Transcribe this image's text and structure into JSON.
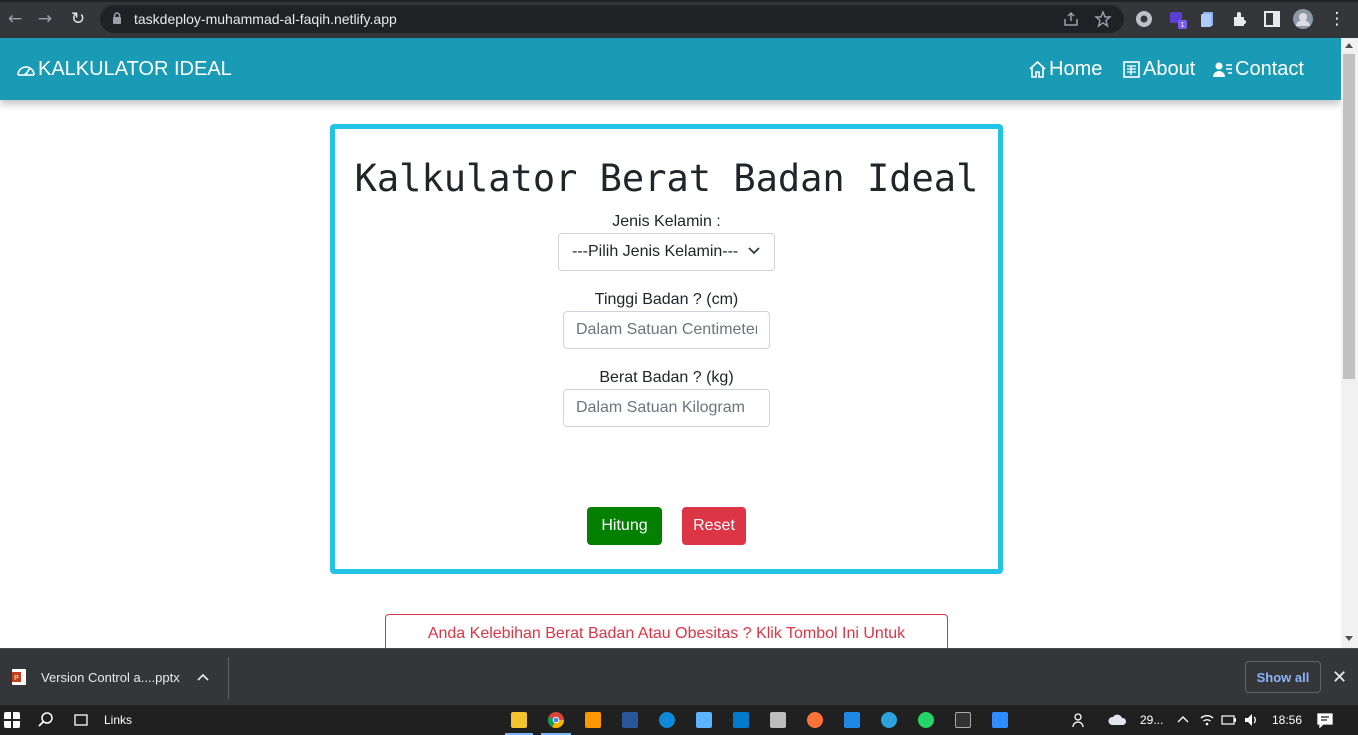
{
  "browser": {
    "url": "taskdeploy-muhammad-al-faqih.netlify.app",
    "extension_badge": "1"
  },
  "navbar": {
    "brand": "KALKULATOR IDEAL",
    "links": [
      {
        "label": "Home",
        "icon": "house-icon"
      },
      {
        "label": "About",
        "icon": "newspaper-icon"
      },
      {
        "label": "Contact",
        "icon": "person-lines-icon"
      }
    ],
    "color": "#1a9bb5"
  },
  "card": {
    "title": "Kalkulator Berat Badan Ideal",
    "border_color": "#22c4e5",
    "gender_label": "Jenis Kelamin :",
    "gender_selected": "---Pilih Jenis Kelamin---",
    "height_label": "Tinggi Badan ? (cm)",
    "height_placeholder": "Dalam Satuan Centimeter",
    "weight_label": "Berat Badan ? (kg)",
    "weight_placeholder": "Dalam Satuan Kilogram",
    "hitung_label": "Hitung",
    "reset_label": "Reset"
  },
  "obesity_button": "Anda Kelebihan Berat Badan Atau Obesitas ? Klik Tombol Ini Untuk",
  "downloads": {
    "file_name": "Version Control a....pptx",
    "show_all": "Show all"
  },
  "taskbar": {
    "links_label": "Links",
    "weather": "29...",
    "time": "18:56"
  }
}
